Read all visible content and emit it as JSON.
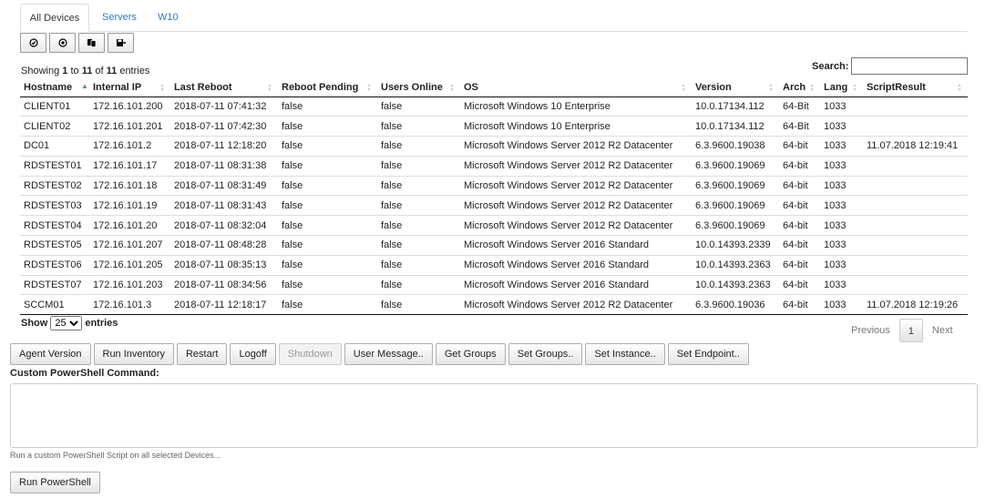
{
  "tabs": [
    "All Devices",
    "Servers",
    "W10"
  ],
  "toolbar_icons": [
    "select-all-icon",
    "deselect-icon",
    "copy-icon",
    "export-icon"
  ],
  "table_info": {
    "prefix": "Showing ",
    "start": "1",
    "to": " to ",
    "end": "11",
    "of": " of ",
    "total": "11",
    "suffix": " entries"
  },
  "search": {
    "label": "Search:",
    "value": ""
  },
  "columns": [
    "Hostname",
    "Internal IP",
    "Last Reboot",
    "Reboot Pending",
    "Users Online",
    "OS",
    "Version",
    "Arch",
    "Lang",
    "ScriptResult"
  ],
  "rows": [
    [
      "CLIENT01",
      "172.16.101.200",
      "2018-07-11 07:41:32",
      "false",
      "false",
      "Microsoft Windows 10 Enterprise",
      "10.0.17134.112",
      "64-Bit",
      "1033",
      ""
    ],
    [
      "CLIENT02",
      "172.16.101.201",
      "2018-07-11 07:42:30",
      "false",
      "false",
      "Microsoft Windows 10 Enterprise",
      "10.0.17134.112",
      "64-Bit",
      "1033",
      ""
    ],
    [
      "DC01",
      "172.16.101.2",
      "2018-07-11 12:18:20",
      "false",
      "false",
      "Microsoft Windows Server 2012 R2 Datacenter",
      "6.3.9600.19038",
      "64-bit",
      "1033",
      "11.07.2018 12:19:41"
    ],
    [
      "RDSTEST01",
      "172.16.101.17",
      "2018-07-11 08:31:38",
      "false",
      "false",
      "Microsoft Windows Server 2012 R2 Datacenter",
      "6.3.9600.19069",
      "64-bit",
      "1033",
      ""
    ],
    [
      "RDSTEST02",
      "172.16.101.18",
      "2018-07-11 08:31:49",
      "false",
      "false",
      "Microsoft Windows Server 2012 R2 Datacenter",
      "6.3.9600.19069",
      "64-bit",
      "1033",
      ""
    ],
    [
      "RDSTEST03",
      "172.16.101.19",
      "2018-07-11 08:31:43",
      "false",
      "false",
      "Microsoft Windows Server 2012 R2 Datacenter",
      "6.3.9600.19069",
      "64-bit",
      "1033",
      ""
    ],
    [
      "RDSTEST04",
      "172.16.101.20",
      "2018-07-11 08:32:04",
      "false",
      "false",
      "Microsoft Windows Server 2012 R2 Datacenter",
      "6.3.9600.19069",
      "64-bit",
      "1033",
      ""
    ],
    [
      "RDSTEST05",
      "172.16.101.207",
      "2018-07-11 08:48:28",
      "false",
      "false",
      "Microsoft Windows Server 2016 Standard",
      "10.0.14393.2339",
      "64-bit",
      "1033",
      ""
    ],
    [
      "RDSTEST06",
      "172.16.101.205",
      "2018-07-11 08:35:13",
      "false",
      "false",
      "Microsoft Windows Server 2016 Standard",
      "10.0.14393.2363",
      "64-bit",
      "1033",
      ""
    ],
    [
      "RDSTEST07",
      "172.16.101.203",
      "2018-07-11 08:34:56",
      "false",
      "false",
      "Microsoft Windows Server 2016 Standard",
      "10.0.14393.2363",
      "64-bit",
      "1033",
      ""
    ],
    [
      "SCCM01",
      "172.16.101.3",
      "2018-07-11 12:18:17",
      "false",
      "false",
      "Microsoft Windows Server 2012 R2 Datacenter",
      "6.3.9600.19036",
      "64-bit",
      "1033",
      "11.07.2018 12:19:26"
    ]
  ],
  "length_menu": {
    "show": "Show",
    "value": "25",
    "entries": "entries"
  },
  "pagination": {
    "previous": "Previous",
    "current": "1",
    "next": "Next"
  },
  "actions": [
    {
      "label": "Agent Version",
      "name": "agent-version-button",
      "enabled": true
    },
    {
      "label": "Run Inventory",
      "name": "run-inventory-button",
      "enabled": true
    },
    {
      "label": "Restart",
      "name": "restart-button",
      "enabled": true
    },
    {
      "label": "Logoff",
      "name": "logoff-button",
      "enabled": true
    },
    {
      "label": "Shutdown",
      "name": "shutdown-button",
      "enabled": false
    },
    {
      "label": "User Message..",
      "name": "user-message-button",
      "enabled": true
    },
    {
      "label": "Get Groups",
      "name": "get-groups-button",
      "enabled": true
    },
    {
      "label": "Set Groups..",
      "name": "set-groups-button",
      "enabled": true
    },
    {
      "label": "Set Instance..",
      "name": "set-instance-button",
      "enabled": true
    },
    {
      "label": "Set Endpoint..",
      "name": "set-endpoint-button",
      "enabled": true
    }
  ],
  "powershell": {
    "label": "Custom PowerShell Command:",
    "value": "",
    "hint": "Run a custom PowerShell Script on all selected Devices...",
    "run_label": "Run PowerShell"
  }
}
